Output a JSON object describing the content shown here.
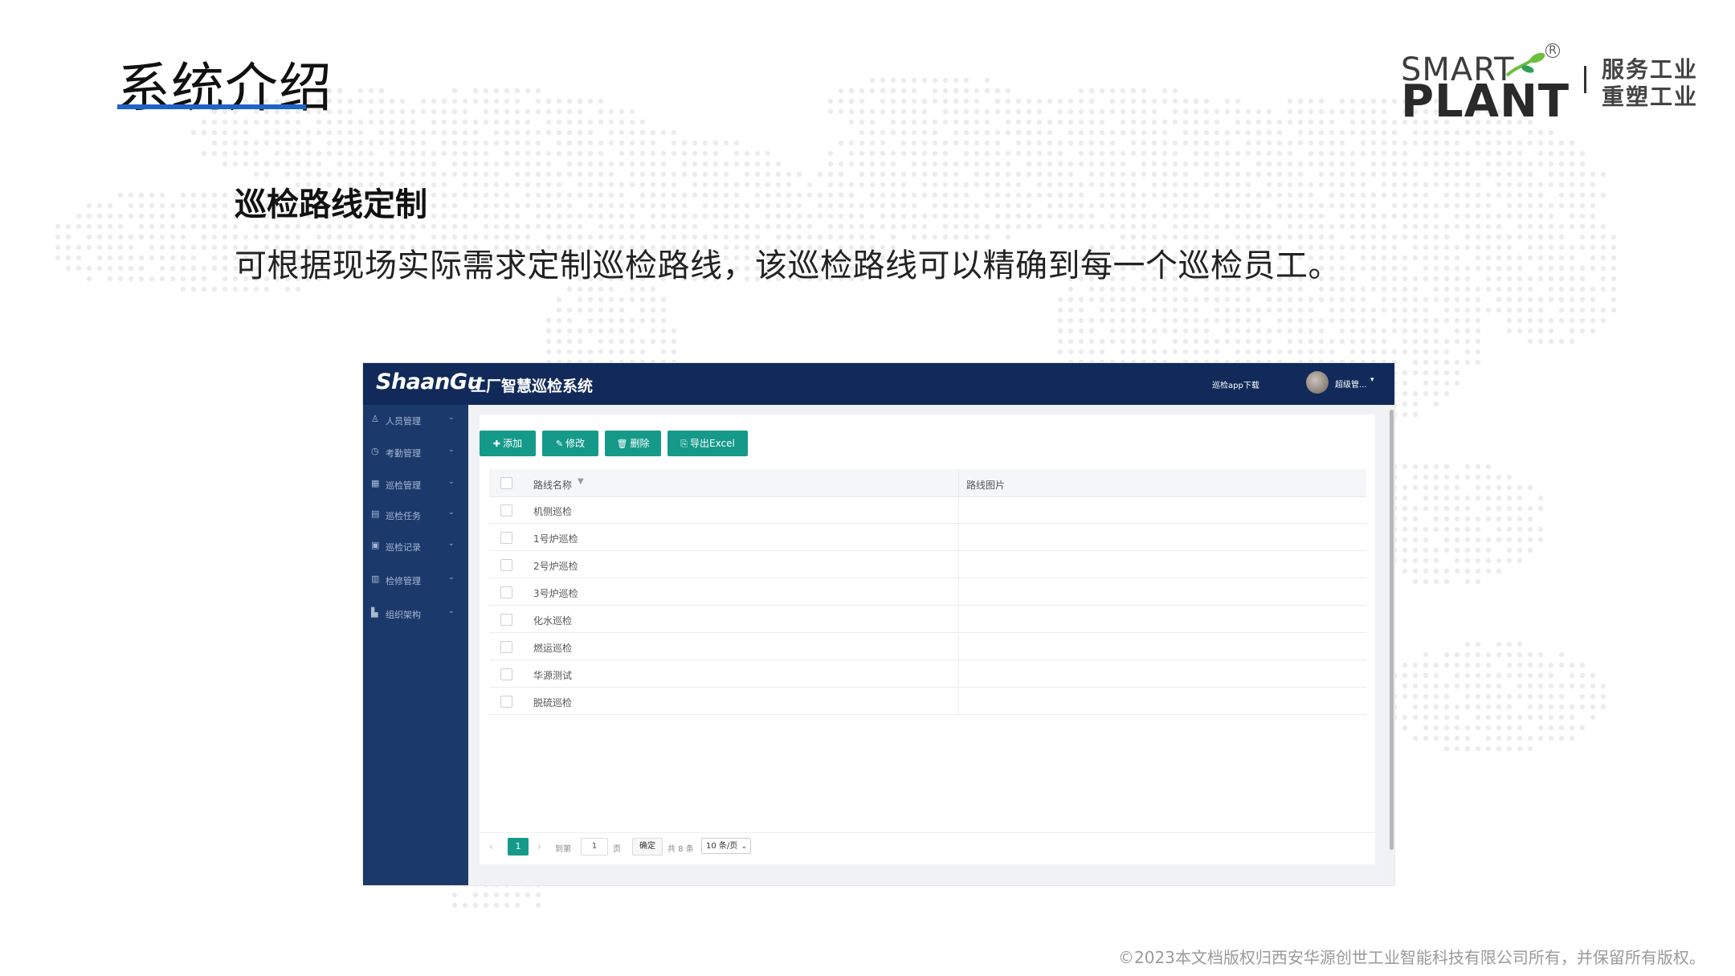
{
  "slide": {
    "title": "系统介绍",
    "heading": "巡检路线定制",
    "description": "可根据现场实际需求定制巡检路线，该巡检路线可以精确到每一个巡检员工。",
    "copyright": "©2023本文档版权归西安华源创世工业智能科技有限公司所有，并保留所有版权。",
    "accent_color": "#1f63c6"
  },
  "logo": {
    "line1": "SMART",
    "line2": "PLANT",
    "registered": "R",
    "slogan_line1": "服务工业",
    "slogan_line2": "重塑工业"
  },
  "app": {
    "brand": "ShaanGu",
    "system_name": "工厂智慧巡检系统",
    "download_link": "巡检app下载",
    "user_name": "超级管...",
    "theme_color": "#159a8a",
    "topbar_color": "#112a59",
    "sidebar_color": "#1b3a6b",
    "sidebar": [
      {
        "label": "人员管理",
        "icon": "person-icon"
      },
      {
        "label": "考勤管理",
        "icon": "clock-icon"
      },
      {
        "label": "巡检管理",
        "icon": "grid-icon"
      },
      {
        "label": "巡检任务",
        "icon": "task-icon"
      },
      {
        "label": "巡检记录",
        "icon": "record-icon"
      },
      {
        "label": "检修管理",
        "icon": "repair-icon"
      },
      {
        "label": "组织架构",
        "icon": "org-icon"
      }
    ],
    "toolbar": {
      "add": "添加",
      "edit": "修改",
      "delete": "删除",
      "export": "导出Excel"
    },
    "table": {
      "columns": [
        "路线名称",
        "路线图片"
      ],
      "rows": [
        "机侧巡检",
        "1号炉巡检",
        "2号炉巡检",
        "3号炉巡检",
        "化水巡检",
        "燃运巡检",
        "华源测试",
        "脱硫巡检"
      ]
    },
    "pagination": {
      "current_page": "1",
      "goto_label": "到第",
      "page_input": "1",
      "page_unit": "页",
      "confirm": "确定",
      "total": "共 8 条",
      "page_size": "10 条/页"
    }
  }
}
